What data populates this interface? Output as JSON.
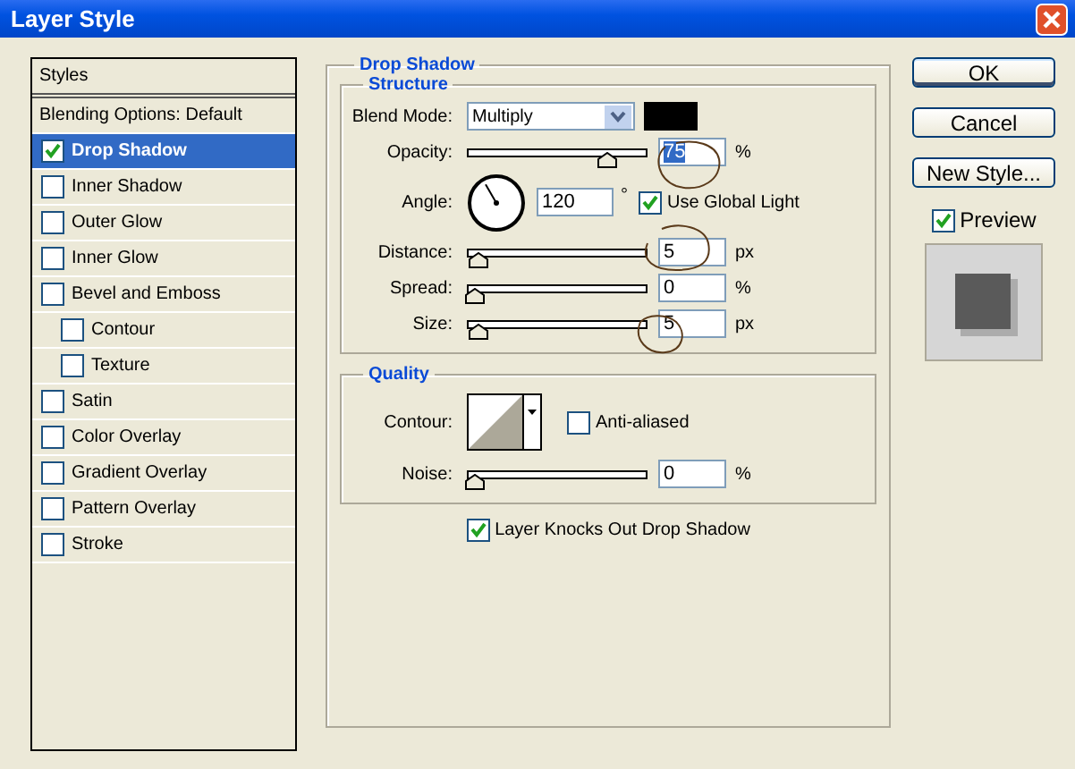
{
  "window": {
    "title": "Layer Style"
  },
  "sidebar": {
    "header": "Styles",
    "blending_options": "Blending Options: Default",
    "items": [
      {
        "label": "Drop Shadow",
        "checked": true,
        "selected": true
      },
      {
        "label": "Inner Shadow",
        "checked": false,
        "selected": false
      },
      {
        "label": "Outer Glow",
        "checked": false,
        "selected": false
      },
      {
        "label": "Inner Glow",
        "checked": false,
        "selected": false
      },
      {
        "label": "Bevel and Emboss",
        "checked": false,
        "selected": false,
        "children": [
          {
            "label": "Contour",
            "checked": false,
            "selected": false
          },
          {
            "label": "Texture",
            "checked": false,
            "selected": false
          }
        ]
      },
      {
        "label": "Satin",
        "checked": false,
        "selected": false
      },
      {
        "label": "Color Overlay",
        "checked": false,
        "selected": false
      },
      {
        "label": "Gradient Overlay",
        "checked": false,
        "selected": false
      },
      {
        "label": "Pattern Overlay",
        "checked": false,
        "selected": false
      },
      {
        "label": "Stroke",
        "checked": false,
        "selected": false
      }
    ]
  },
  "panel": {
    "title": "Drop Shadow",
    "structure": {
      "title": "Structure",
      "blend_mode": {
        "label": "Blend Mode:",
        "value": "Multiply",
        "color": "#000000"
      },
      "opacity": {
        "label": "Opacity:",
        "level": 0.75,
        "value": "75",
        "unit": "%",
        "text_selected": true
      },
      "angle": {
        "label": "Angle:",
        "value": "120",
        "unit": "°",
        "use_global_light": {
          "label": "Use Global Light",
          "checked": true
        }
      },
      "sliders": [
        {
          "label": "Distance:",
          "level": 0.02,
          "value": "5",
          "unit": "px",
          "text_selected": false
        },
        {
          "label": "Spread:",
          "level": 0,
          "value": "0",
          "unit": "%",
          "text_selected": false
        },
        {
          "label": "Size:",
          "level": 0.02,
          "value": "5",
          "unit": "px",
          "text_selected": false
        }
      ]
    },
    "quality": {
      "title": "Quality",
      "contour_label": "Contour:",
      "anti_aliased": {
        "label": "Anti-aliased",
        "checked": false
      },
      "noise": {
        "label": "Noise:",
        "level": 0,
        "value": "0",
        "unit": "%",
        "text_selected": false
      }
    },
    "knockout": {
      "label": "Layer Knocks Out Drop Shadow",
      "checked": true
    }
  },
  "buttons": [
    {
      "label": "OK",
      "default": true
    },
    {
      "label": "Cancel",
      "default": false
    },
    {
      "label": "New Style...",
      "default": false
    }
  ],
  "preview": {
    "label": "Preview",
    "checked": true
  }
}
